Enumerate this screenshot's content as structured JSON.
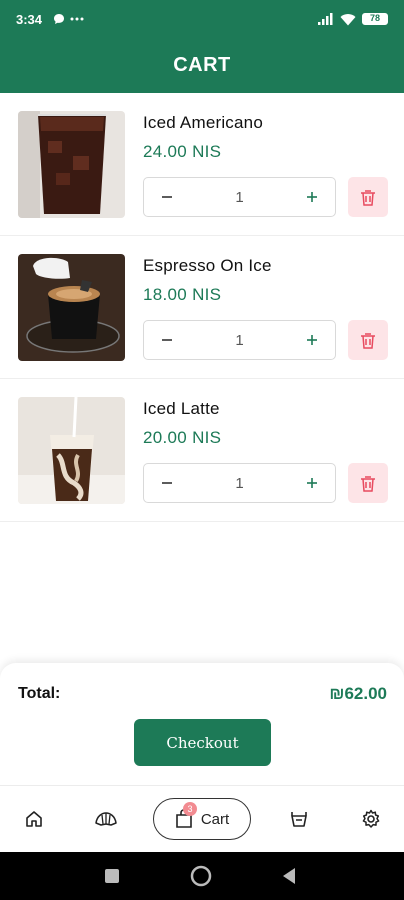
{
  "status_bar": {
    "time": "3:34",
    "battery": "78"
  },
  "header": {
    "title": "CART"
  },
  "items": [
    {
      "name": "Iced Americano",
      "price": "24.00 NIS",
      "quantity": "1"
    },
    {
      "name": "Espresso On Ice",
      "price": "18.00 NIS",
      "quantity": "1"
    },
    {
      "name": "Iced Latte",
      "price": "20.00 NIS",
      "quantity": "1"
    }
  ],
  "summary": {
    "total_label": "Total:",
    "total_value": "₪62.00",
    "checkout_label": "Checkout"
  },
  "nav": {
    "cart_label": "Cart",
    "cart_badge": "3"
  },
  "colors": {
    "primary": "#1d7a57",
    "delete_bg": "#fde4e7",
    "delete_icon": "#e84a5f",
    "badge": "#f28b91"
  },
  "icons": [
    "home-icon",
    "croissant-icon",
    "shopping-bag-icon",
    "basket-icon",
    "gear-icon",
    "trash-icon",
    "minus-icon",
    "plus-icon"
  ]
}
